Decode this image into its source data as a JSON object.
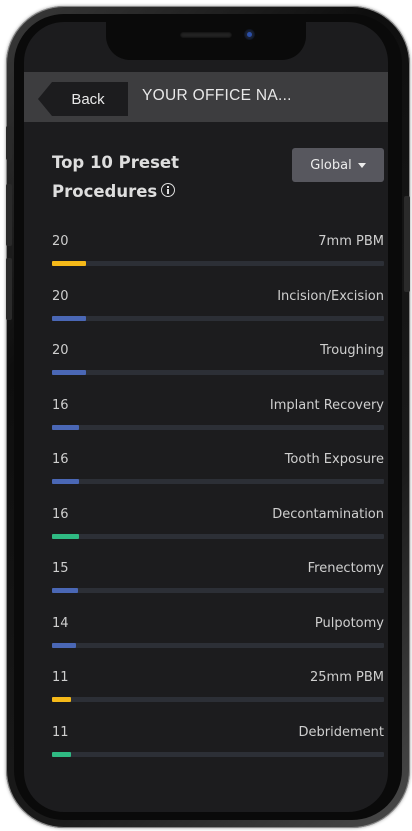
{
  "header": {
    "back_label": "Back",
    "office_name": "YOUR OFFICE NA..."
  },
  "section": {
    "title_line1": "Top 10 Preset",
    "title_line2": "Procedures",
    "filter_label": "Global"
  },
  "colors": {
    "yellow": "#f5b919",
    "blue": "#4a67b5",
    "green": "#2fba83",
    "track": "#2c2f36"
  },
  "procedures": [
    {
      "count": "20",
      "name": "7mm PBM",
      "value": 20,
      "color": "yellow"
    },
    {
      "count": "20",
      "name": "Incision/Excision",
      "value": 20,
      "color": "blue"
    },
    {
      "count": "20",
      "name": "Troughing",
      "value": 20,
      "color": "blue"
    },
    {
      "count": "16",
      "name": "Implant Recovery",
      "value": 16,
      "color": "blue"
    },
    {
      "count": "16",
      "name": "Tooth Exposure",
      "value": 16,
      "color": "blue"
    },
    {
      "count": "16",
      "name": "Decontamination",
      "value": 16,
      "color": "green"
    },
    {
      "count": "15",
      "name": "Frenectomy",
      "value": 15,
      "color": "blue"
    },
    {
      "count": "14",
      "name": "Pulpotomy",
      "value": 14,
      "color": "blue"
    },
    {
      "count": "11",
      "name": "25mm PBM",
      "value": 11,
      "color": "yellow"
    },
    {
      "count": "11",
      "name": "Debridement",
      "value": 11,
      "color": "green"
    }
  ]
}
